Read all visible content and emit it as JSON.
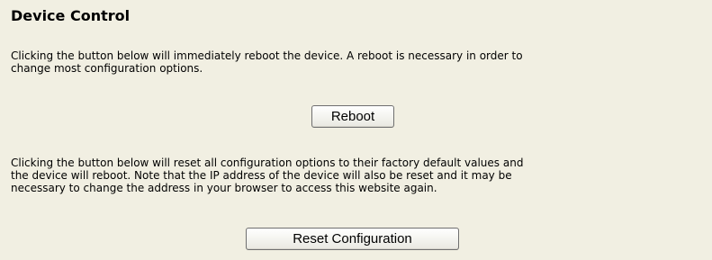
{
  "section": {
    "title": "Device Control"
  },
  "reboot": {
    "description_lines": [
      "Clicking the button below will immediately reboot the device. A reboot is necessary in order to",
      "change most configuration options."
    ],
    "button_label": "Reboot"
  },
  "reset": {
    "description_lines": [
      "Clicking the button below will reset all configuration options to their factory default values and",
      "the device will reboot. Note that the IP address of the device will also be reset and it may be",
      "necessary to change the address in your browser to access this website again."
    ],
    "button_label": "Reset Configuration"
  },
  "colors": {
    "background": "#f1efe2",
    "text": "#000000",
    "button_border": "#6f6f6f"
  }
}
